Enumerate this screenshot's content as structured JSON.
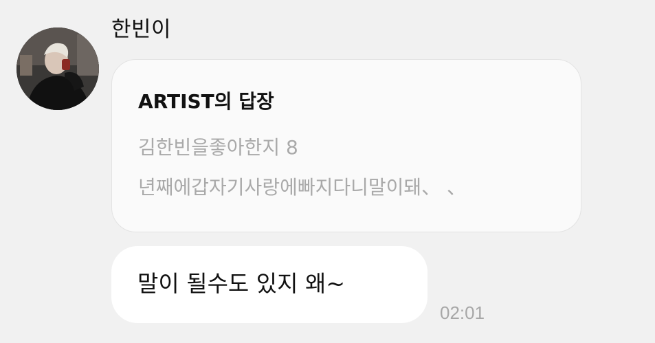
{
  "sender": {
    "name": "한빈이",
    "avatar_icon": "profile-photo"
  },
  "reply": {
    "header": "ARTIST의 답장",
    "quoted_lines": [
      "김한빈을좋아한지 8",
      "년째에갑자기사랑에빠지다니말이돼、 、"
    ]
  },
  "message": {
    "text": "말이 될수도 있지 왜~",
    "time": "02:01"
  },
  "colors": {
    "background": "#f1f1f1",
    "bubble": "#ffffff",
    "reply_bubble": "#fafafa",
    "muted_text": "#a9a9a9"
  }
}
